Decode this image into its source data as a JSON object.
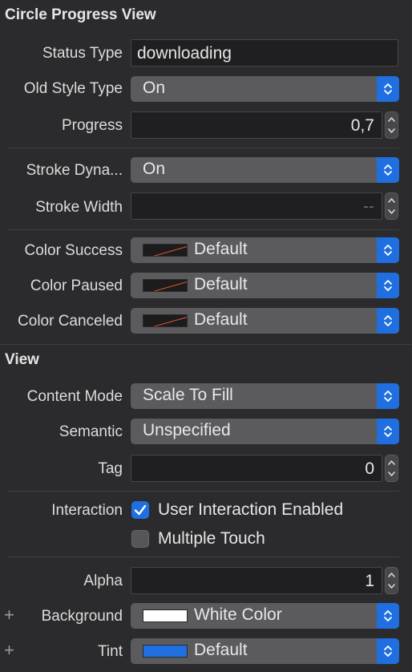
{
  "circle_progress": {
    "title": "Circle Progress View",
    "status_type": {
      "label": "Status Type",
      "value": "downloading"
    },
    "old_style_type": {
      "label": "Old Style Type",
      "value": "On"
    },
    "progress": {
      "label": "Progress",
      "value": "0,7"
    },
    "stroke_dynamic": {
      "label": "Stroke Dyna...",
      "value": "On"
    },
    "stroke_width": {
      "label": "Stroke Width",
      "value": "--"
    },
    "color_success": {
      "label": "Color Success",
      "value": "Default"
    },
    "color_paused": {
      "label": "Color Paused",
      "value": "Default"
    },
    "color_canceled": {
      "label": "Color Canceled",
      "value": "Default"
    }
  },
  "view": {
    "title": "View",
    "content_mode": {
      "label": "Content Mode",
      "value": "Scale To Fill"
    },
    "semantic": {
      "label": "Semantic",
      "value": "Unspecified"
    },
    "tag": {
      "label": "Tag",
      "value": "0"
    },
    "interaction": {
      "label": "Interaction",
      "user_interaction": {
        "label": "User Interaction Enabled",
        "checked": true
      },
      "multiple_touch": {
        "label": "Multiple Touch",
        "checked": false
      }
    },
    "alpha": {
      "label": "Alpha",
      "value": "1"
    },
    "background": {
      "label": "Background",
      "value": "White Color",
      "swatch_color": "#ffffff"
    },
    "tint": {
      "label": "Tint",
      "value": "Default",
      "swatch_color": "#1f6fe0"
    }
  },
  "colors": {
    "accent": "#1f6fe0",
    "panel": "#2b2b2d",
    "popup": "#5b5b5e",
    "field": "#1f1f21",
    "default_swatch_slash": "#e0503a"
  },
  "icons": {
    "popup_arrows": "up-down-chevron-icon",
    "stepper": "stepper-arrows-icon",
    "checkmark": "checkmark-icon",
    "plus": "plus-icon"
  }
}
